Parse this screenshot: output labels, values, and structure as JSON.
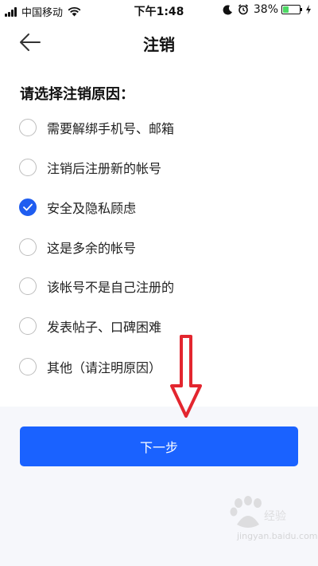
{
  "status_bar": {
    "carrier": "中国移动",
    "time": "下午1:48",
    "battery": "38%",
    "battery_level": 0.38
  },
  "nav": {
    "title": "注销",
    "back_icon": "back-arrow-icon"
  },
  "prompt": "请选择注销原因：",
  "options": [
    {
      "label": "需要解绑手机号、邮箱",
      "checked": false
    },
    {
      "label": "注销后注册新的帐号",
      "checked": false
    },
    {
      "label": "安全及隐私顾虑",
      "checked": true
    },
    {
      "label": "这是多余的帐号",
      "checked": false
    },
    {
      "label": "该帐号不是自己注册的",
      "checked": false
    },
    {
      "label": "发表帖子、口碑困难",
      "checked": false
    },
    {
      "label": "其他（请注明原因）",
      "checked": false
    }
  ],
  "next_button": {
    "label": "下一步"
  },
  "watermark": {
    "text": "jingyan.baidu.com"
  },
  "colors": {
    "accent": "#1a62ff",
    "checked": "#1f5df0",
    "annotation": "#e3262f",
    "battery_fill": "#4cd964"
  }
}
